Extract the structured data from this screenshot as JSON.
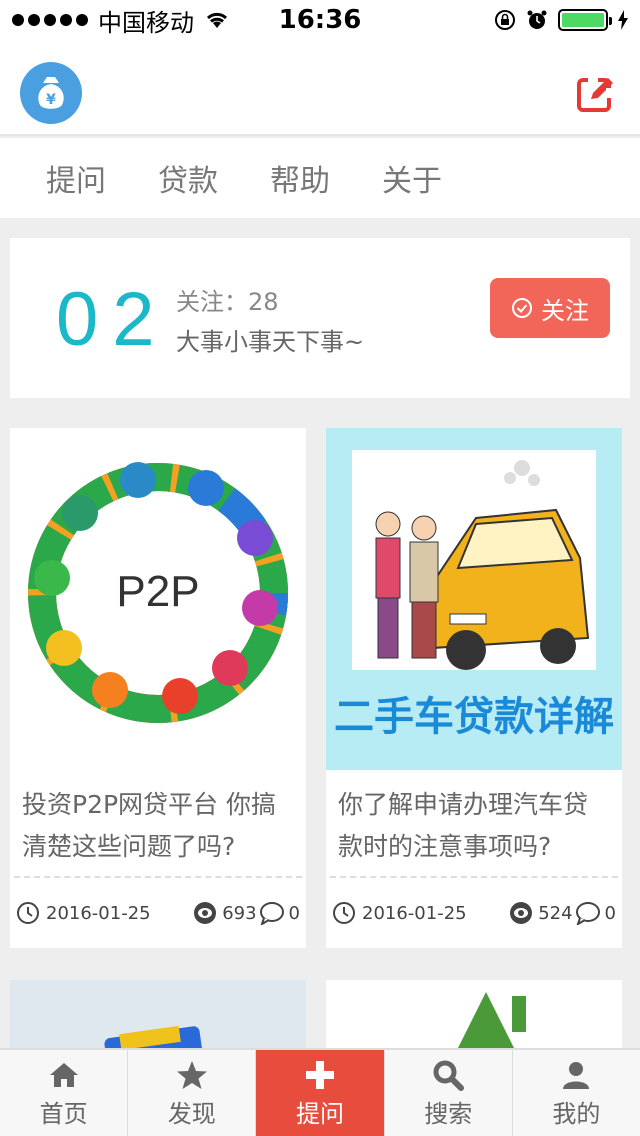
{
  "status_bar": {
    "carrier": "中国移动",
    "time": "16:36"
  },
  "nav": {
    "tabs": [
      "提问",
      "贷款",
      "帮助",
      "关于"
    ]
  },
  "topic": {
    "number": "02",
    "follow_count": "关注：28",
    "description": "大事小事天下事~",
    "follow_button": "关注"
  },
  "articles": [
    {
      "image_text": "P2P",
      "title": "投资P2P网贷平台 你搞清楚这些问题了吗?",
      "date": "2016-01-25",
      "views": "693",
      "comments": "0"
    },
    {
      "image_text": "二手车贷款详解",
      "title": "你了解申请办理汽车贷款时的注意事项吗?",
      "date": "2016-01-25",
      "views": "524",
      "comments": "0"
    }
  ],
  "tabbar": {
    "items": [
      {
        "label": "首页",
        "icon": "home-icon"
      },
      {
        "label": "发现",
        "icon": "star-icon"
      },
      {
        "label": "提问",
        "icon": "plus-icon"
      },
      {
        "label": "搜索",
        "icon": "search-icon"
      },
      {
        "label": "我的",
        "icon": "user-icon"
      }
    ],
    "active_index": 2
  },
  "colors": {
    "accent_teal": "#1bb8c8",
    "follow_red": "#f26659",
    "tab_active": "#e74c3c",
    "logo_blue": "#4a9fe0",
    "edit_red": "#e53935"
  }
}
